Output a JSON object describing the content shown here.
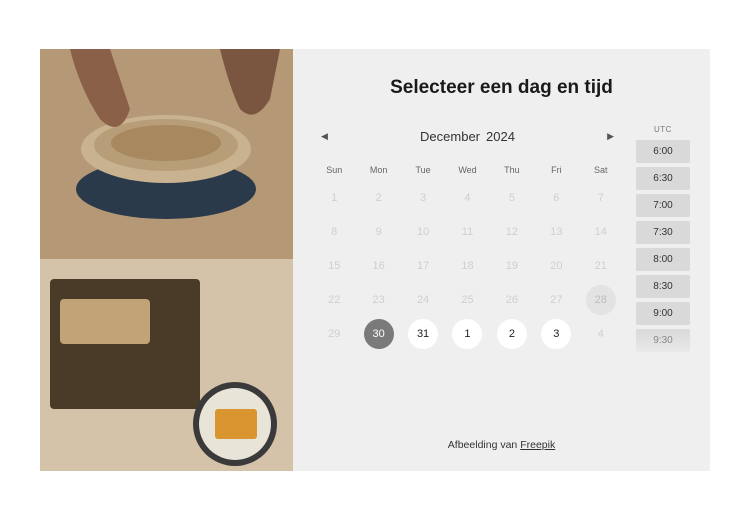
{
  "heading": "Selecteer een dag en tijd",
  "month": "December",
  "year": "2024",
  "dow": [
    "Sun",
    "Mon",
    "Tue",
    "Wed",
    "Thu",
    "Fri",
    "Sat"
  ],
  "weeks": [
    [
      {
        "n": "1",
        "state": "dim"
      },
      {
        "n": "2",
        "state": "dim"
      },
      {
        "n": "3",
        "state": "dim"
      },
      {
        "n": "4",
        "state": "dim"
      },
      {
        "n": "5",
        "state": "dim"
      },
      {
        "n": "6",
        "state": "dim"
      },
      {
        "n": "7",
        "state": "dim"
      }
    ],
    [
      {
        "n": "8",
        "state": "dim"
      },
      {
        "n": "9",
        "state": "dim"
      },
      {
        "n": "10",
        "state": "dim"
      },
      {
        "n": "11",
        "state": "dim"
      },
      {
        "n": "12",
        "state": "dim"
      },
      {
        "n": "13",
        "state": "dim"
      },
      {
        "n": "14",
        "state": "dim"
      }
    ],
    [
      {
        "n": "15",
        "state": "dim"
      },
      {
        "n": "16",
        "state": "dim"
      },
      {
        "n": "17",
        "state": "dim"
      },
      {
        "n": "18",
        "state": "dim"
      },
      {
        "n": "19",
        "state": "dim"
      },
      {
        "n": "20",
        "state": "dim"
      },
      {
        "n": "21",
        "state": "dim"
      }
    ],
    [
      {
        "n": "22",
        "state": "dim"
      },
      {
        "n": "23",
        "state": "dim"
      },
      {
        "n": "24",
        "state": "dim"
      },
      {
        "n": "25",
        "state": "dim"
      },
      {
        "n": "26",
        "state": "dim"
      },
      {
        "n": "27",
        "state": "dim"
      },
      {
        "n": "28",
        "state": "hover"
      }
    ],
    [
      {
        "n": "29",
        "state": "dim"
      },
      {
        "n": "30",
        "state": "selected"
      },
      {
        "n": "31",
        "state": "avail"
      },
      {
        "n": "1",
        "state": "avail"
      },
      {
        "n": "2",
        "state": "avail"
      },
      {
        "n": "3",
        "state": "avail"
      },
      {
        "n": "4",
        "state": "dim"
      }
    ]
  ],
  "timezone": "UTC",
  "times": [
    "6:00",
    "6:30",
    "7:00",
    "7:30",
    "8:00",
    "8:30",
    "9:00",
    "9:30"
  ],
  "attribution_prefix": "Afbeelding van ",
  "attribution_link": "Freepik"
}
